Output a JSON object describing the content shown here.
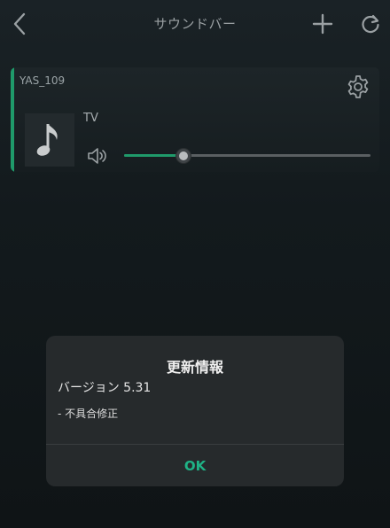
{
  "header": {
    "title": "サウンドバー",
    "back_icon": "chevron-left-icon",
    "add_icon": "plus-icon",
    "refresh_icon": "refresh-icon"
  },
  "device": {
    "name": "YAS_109",
    "source": "TV",
    "volume_level": 0.24,
    "accent_color": "#1f9a6a",
    "settings_icon": "gear-icon",
    "art_icon": "music-note-icon",
    "volume_icon": "speaker-icon"
  },
  "dialog": {
    "title": "更新情報",
    "version": "バージョン 5.31",
    "note": "- 不具合修正",
    "ok_label": "OK",
    "ok_color": "#1fb386"
  }
}
